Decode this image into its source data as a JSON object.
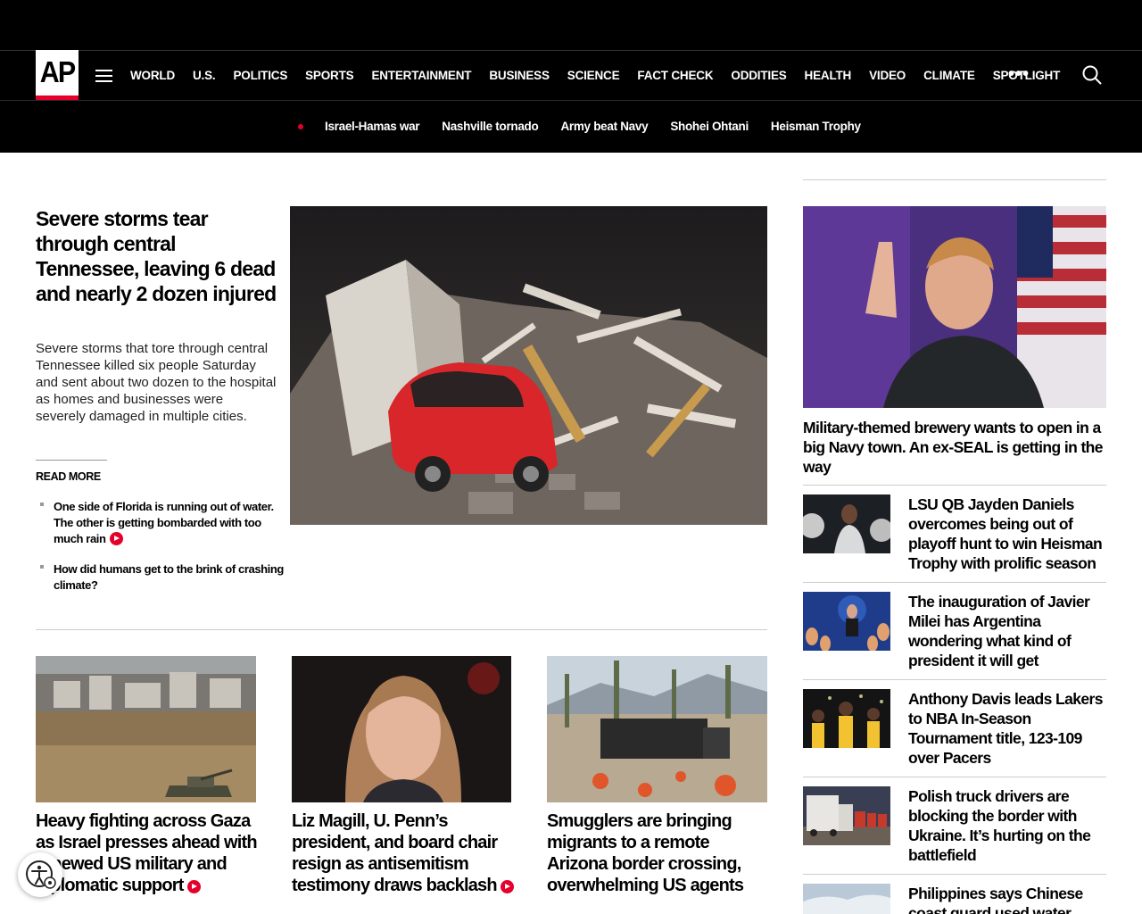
{
  "brand": {
    "logo_text": "AP",
    "accent": "#e4002b"
  },
  "nav": {
    "menu_icon": "hamburger-icon",
    "items": [
      "WORLD",
      "U.S.",
      "POLITICS",
      "SPORTS",
      "ENTERTAINMENT",
      "BUSINESS",
      "SCIENCE",
      "FACT CHECK",
      "ODDITIES",
      "HEALTH",
      "VIDEO",
      "CLIMATE",
      "SPOTLIGHT"
    ],
    "more": "•••",
    "search_icon": "search-icon"
  },
  "trending": [
    "Israel-Hamas war",
    "Nashville tornado",
    "Army beat Navy",
    "Shohei Ohtani",
    "Heisman Trophy"
  ],
  "lead": {
    "title": "Severe storms tear through central Tennessee, leaving 6 dead and nearly 2 dozen injured",
    "description": "Severe storms that tore through central Tennessee killed six people Saturday and sent about two dozen to the hospital as homes and businesses were severely damaged in multiple cities.",
    "read_more": "READ MORE",
    "related": [
      {
        "title": "One side of Florida is running out of water. The other is getting bombarded with too much rain",
        "video": true
      },
      {
        "title": "How did humans get to the brink of crashing climate?",
        "video": false
      }
    ]
  },
  "cards": [
    {
      "title": "Heavy fighting across Gaza as Israel presses ahead with renewed US military and diplomatic support",
      "video": true
    },
    {
      "title": "Liz Magill, U. Penn’s president, and board chair resign as antisemitism testimony draws backlash",
      "video": true
    },
    {
      "title": "Smugglers are bringing migrants to a remote Arizona border crossing, overwhelming US agents",
      "video": false
    }
  ],
  "rail": {
    "feature": {
      "title": "Military-themed brewery wants to open in a big Navy town. An ex-SEAL is getting in the way"
    },
    "items": [
      {
        "title": "LSU QB Jayden Daniels overcomes being out of playoff hunt to win Heisman Trophy with prolific season"
      },
      {
        "title": "The inauguration of Javier Milei has Argentina wondering what kind of president it will get"
      },
      {
        "title": "Anthony Davis leads Lakers to NBA In-Season Tournament title, 123-109 over Pacers"
      },
      {
        "title": "Polish truck drivers are blocking the border with Ukraine. It’s hurting on the battlefield"
      },
      {
        "title": "Philippines says Chinese coast guard used water cannon"
      }
    ]
  }
}
